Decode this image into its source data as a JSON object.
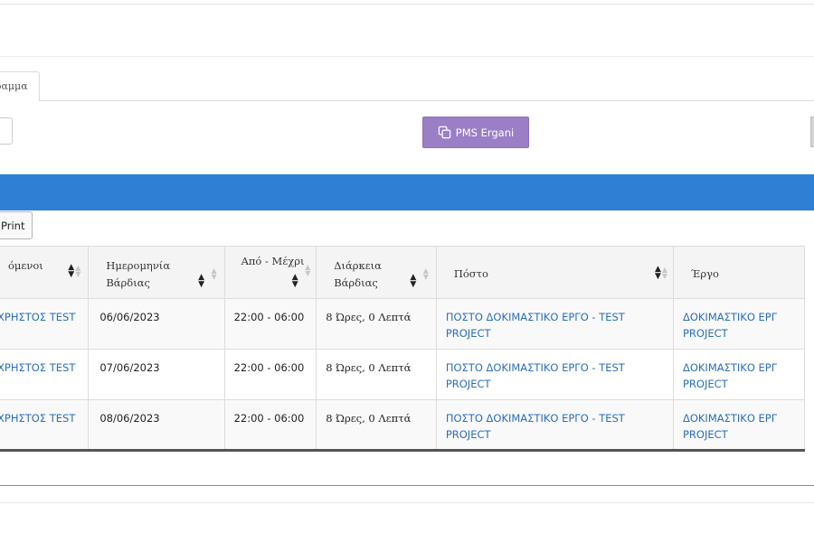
{
  "tabs": [
    {
      "label": "ραμμα"
    }
  ],
  "toolbar": {
    "pms_label": "PMS Ergani",
    "print_label": "Print"
  },
  "table": {
    "columns": [
      {
        "label": "όμενοι"
      },
      {
        "label": "Ημερομηνία Βάρδιας"
      },
      {
        "label": "Από - Μέχρι"
      },
      {
        "label": "Διάρκεια Βάρδιας"
      },
      {
        "label": "Πόστο"
      },
      {
        "label": "Έργο"
      }
    ],
    "rows": [
      {
        "employee": "ΧΡΗΣΤΟΣ TEST",
        "date": "06/06/2023",
        "time": "22:00 - 06:00",
        "duration": "8 Ώρες, 0 Λεπτά",
        "post": "ΠΟΣΤΟ ΔΟΚΙΜΑΣΤΙΚΟ ΕΡΓΟ - TEST PROJECT",
        "project": "ΔΟΚΙΜΑΣΤΙΚΟ ΕΡΓ PROJECT"
      },
      {
        "employee": "ΧΡΗΣΤΟΣ TEST",
        "date": "07/06/2023",
        "time": "22:00 - 06:00",
        "duration": "8 Ώρες, 0 Λεπτά",
        "post": "ΠΟΣΤΟ ΔΟΚΙΜΑΣΤΙΚΟ ΕΡΓΟ - TEST PROJECT",
        "project": "ΔΟΚΙΜΑΣΤΙΚΟ ΕΡΓ PROJECT"
      },
      {
        "employee": "ΧΡΗΣΤΟΣ TEST",
        "date": "08/06/2023",
        "time": "22:00 - 06:00",
        "duration": "8 Ώρες, 0 Λεπτά",
        "post": "ΠΟΣΤΟ ΔΟΚΙΜΑΣΤΙΚΟ ΕΡΓΟ - TEST PROJECT",
        "project": "ΔΟΚΙΜΑΣΤΙΚΟ ΕΡΓ PROJECT"
      }
    ]
  },
  "colors": {
    "header_bar": "#2f7fd4",
    "pms_button": "#9a7fc7",
    "link": "#2a6fb8"
  },
  "icons": {
    "pms": "copy-icon",
    "sort": "sort-icon"
  }
}
